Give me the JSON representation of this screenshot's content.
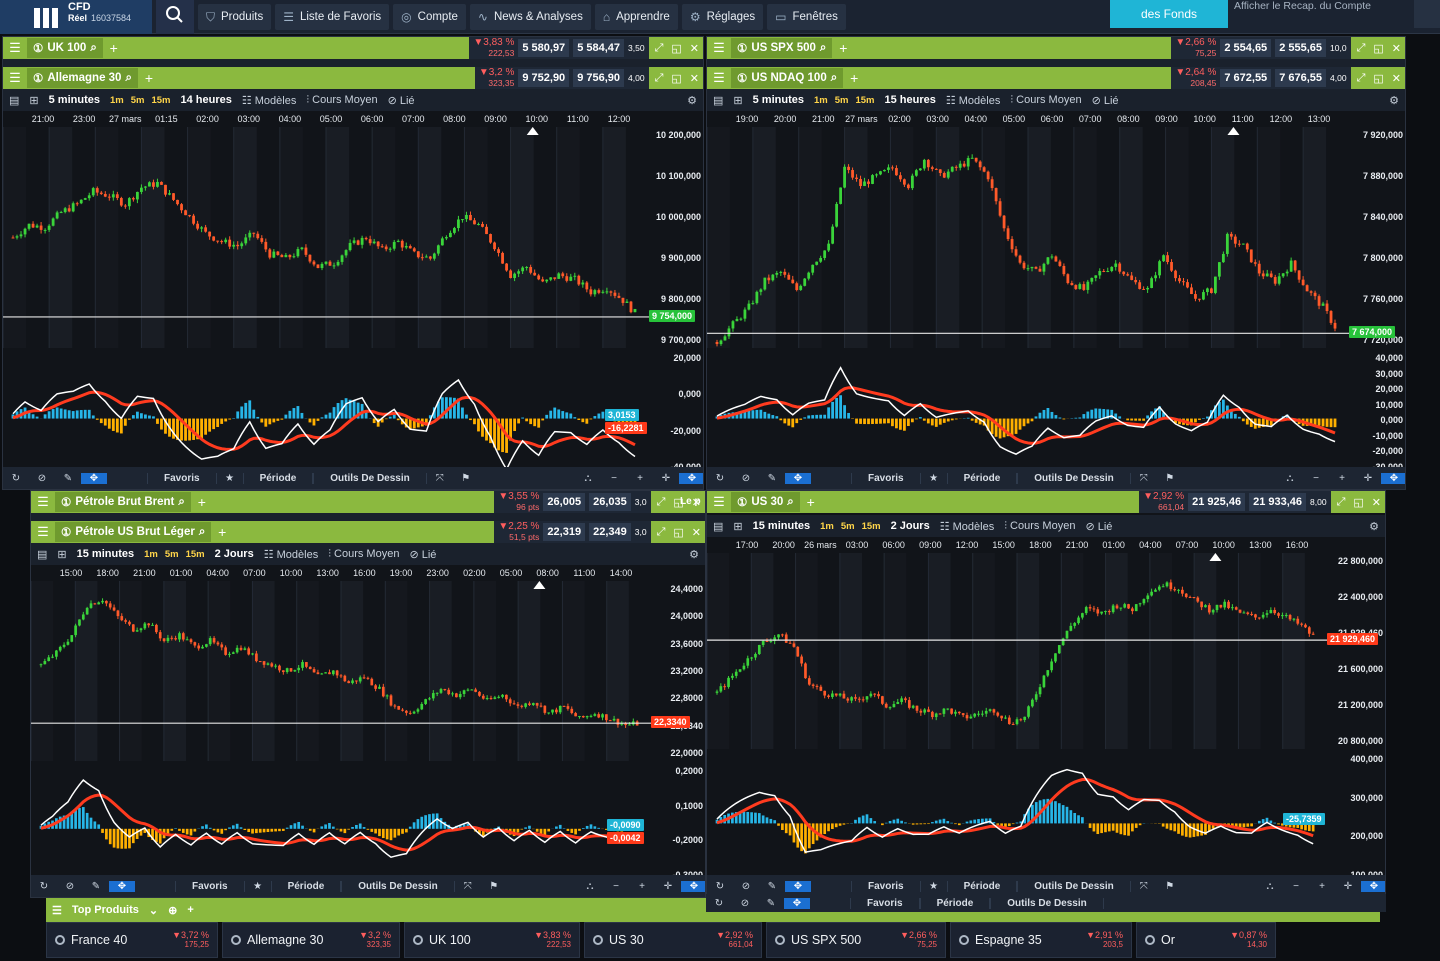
{
  "app": {
    "brand_line1": "CFD",
    "brand_line2_strong": "Réel",
    "brand_line2": "16037584",
    "nav": [
      {
        "icon": "shield-icon",
        "glyph": "⛉",
        "label": "Produits"
      },
      {
        "icon": "list-icon",
        "glyph": "☰",
        "label": "Liste de Favoris"
      },
      {
        "icon": "coins-icon",
        "glyph": "◎",
        "label": "Compte"
      },
      {
        "icon": "pulse-icon",
        "glyph": "∿",
        "label": "News & Analyses"
      },
      {
        "icon": "graduation-icon",
        "glyph": "⌂",
        "label": "Apprendre"
      },
      {
        "icon": "gear-icon",
        "glyph": "⚙",
        "label": "Réglages"
      },
      {
        "icon": "window-icon",
        "glyph": "▭",
        "label": "Fenêtres"
      }
    ],
    "funds_button": "des Fonds",
    "recap_link": "Afficher le Recap. du Compte"
  },
  "colors": {
    "green_bar": "#8bb93f",
    "bull": "#3ad43a",
    "bear": "#ff5a2a",
    "macd_hist_pos": "#27b6e8",
    "macd_hist_neg": "#ffb000",
    "signal": "#ff3b1f",
    "macd_line": "#ffffff"
  },
  "panels": {
    "tl": {
      "header1": {
        "name": "UK 100",
        "chg": "▼3,83 %",
        "chg_pts": "222,53",
        "bid": "5 580,97",
        "ask": "5 584,47",
        "spread": "3,50"
      },
      "header2": {
        "name": "Allemagne 30",
        "chg": "▼3,2 %",
        "chg_pts": "323,35",
        "bid": "9 752,90",
        "ask": "9 756,90",
        "spread": "4,00"
      },
      "period": "5 minutes",
      "range": "14 heures",
      "tools": [
        "Modèles",
        "Cours Moyen",
        "Lié"
      ],
      "timeframes": [
        "1m",
        "5m",
        "15m"
      ],
      "time_ticks": [
        "21:00",
        "23:00",
        "27 mars",
        "01:15",
        "02:00",
        "03:00",
        "04:00",
        "05:00",
        "06:00",
        "07:00",
        "08:00",
        "09:00",
        "10:00",
        "11:00",
        "12:00"
      ],
      "price_ticks": [
        "10 200,000",
        "10 100,000",
        "10 000,000",
        "9 900,000",
        "9 800,000",
        "9 700,000"
      ],
      "macd_ticks": [
        "20,000",
        "0,000",
        "-20,000",
        "-40,000"
      ],
      "price_tag": "9 754,000",
      "macd_tags": [
        "3,0153",
        "-16,2281"
      ],
      "footer": [
        "Favoris",
        "Période",
        "Outils De Dessin"
      ]
    },
    "tr": {
      "header1": {
        "name": "US SPX 500",
        "chg": "▼2,66 %",
        "chg_pts": "75,25",
        "bid": "2 554,65",
        "ask": "2 555,65",
        "spread": "10,0"
      },
      "header2": {
        "name": "US NDAQ 100",
        "chg": "▼2,64 %",
        "chg_pts": "208,45",
        "bid": "7 672,55",
        "ask": "7 676,55",
        "spread": "4,00"
      },
      "period": "5 minutes",
      "range": "15 heures",
      "tools": [
        "Modèles",
        "Cours Moyen",
        "Lié"
      ],
      "timeframes": [
        "1m",
        "5m",
        "15m"
      ],
      "time_ticks": [
        "19:00",
        "20:00",
        "21:00",
        "27 mars",
        "02:00",
        "03:00",
        "04:00",
        "05:00",
        "06:00",
        "07:00",
        "08:00",
        "09:00",
        "10:00",
        "11:00",
        "12:00",
        "13:00"
      ],
      "price_ticks": [
        "7 920,000",
        "7 880,000",
        "7 840,000",
        "7 800,000",
        "7 760,000",
        "7 720,000"
      ],
      "macd_ticks": [
        "40,000",
        "30,000",
        "20,000",
        "10,000",
        "0,000",
        "-10,000",
        "-20,000",
        "-30,000"
      ],
      "price_tag": "7 674,000",
      "footer": [
        "Favoris",
        "Période",
        "Outils De Dessin"
      ]
    },
    "bl": {
      "header1": {
        "name": "Pétrole Brut Brent",
        "chg": "▼3,55 %",
        "chg_pts": "96 pts",
        "bid": "26,005",
        "ask": "26,035",
        "spread": "3,0"
      },
      "header2": {
        "name": "Pétrole US Brut Léger",
        "chg": "▼2,25 %",
        "chg_pts": "51,5 pts",
        "bid": "22,319",
        "ask": "22,349",
        "spread": "3,0"
      },
      "period": "15 minutes",
      "range": "2 Jours",
      "tools": [
        "Modèles",
        "Cours Moyen",
        "Lié"
      ],
      "timeframes": [
        "1m",
        "5m",
        "15m"
      ],
      "time_ticks": [
        "15:00",
        "18:00",
        "21:00",
        "01:00",
        "04:00",
        "07:00",
        "10:00",
        "13:00",
        "16:00",
        "19:00",
        "23:00",
        "02:00",
        "05:00",
        "08:00",
        "11:00",
        "14:00"
      ],
      "price_ticks": [
        "24,4000",
        "24,0000",
        "23,6000",
        "23,2000",
        "22,8000",
        "22,3340",
        "22,0000"
      ],
      "macd_ticks": [
        "0,2000",
        "0,1000",
        "-0,2000",
        "-0,3000"
      ],
      "price_tag": "22,3340",
      "macd_tags": [
        "-0,0090",
        "-0,0042"
      ],
      "footer": [
        "Favoris",
        "Période",
        "Outils De Dessin"
      ],
      "side_text": "Le p"
    },
    "br": {
      "header1": {
        "name": "US 30",
        "chg": "▼2,92 %",
        "chg_pts": "661,04",
        "bid": "21 925,46",
        "ask": "21 933,46",
        "spread": "8,00"
      },
      "period": "15 minutes",
      "range": "2 Jours",
      "tools": [
        "Modèles",
        "Cours Moyen",
        "Lié"
      ],
      "timeframes": [
        "1m",
        "5m",
        "15m"
      ],
      "time_ticks": [
        "17:00",
        "20:00",
        "26 mars",
        "03:00",
        "06:00",
        "09:00",
        "12:00",
        "15:00",
        "18:00",
        "21:00",
        "01:00",
        "04:00",
        "07:00",
        "10:00",
        "13:00",
        "16:00"
      ],
      "price_ticks": [
        "22 800,000",
        "22 400,000",
        "21 929,460",
        "21 600,000",
        "21 200,000",
        "20 800,000"
      ],
      "macd_ticks": [
        "400,000",
        "300,000",
        "200,000",
        "100,000"
      ],
      "price_tag": "21 929,460",
      "macd_tags": [
        "-25,7359"
      ],
      "footer": [
        "Favoris",
        "Période",
        "Outils De Dessin"
      ]
    }
  },
  "ticker": {
    "head": "Top Produits",
    "items": [
      {
        "name": "France 40",
        "chg": "▼3,72 %",
        "pts": "175,25"
      },
      {
        "name": "Allemagne 30",
        "chg": "▼3,2 %",
        "pts": "323,35"
      },
      {
        "name": "UK 100",
        "chg": "▼3,83 %",
        "pts": "222,53"
      },
      {
        "name": "US 30",
        "chg": "▼2,92 %",
        "pts": "661,04"
      },
      {
        "name": "US SPX 500",
        "chg": "▼2,66 %",
        "pts": "75,25"
      },
      {
        "name": "Espagne 35",
        "chg": "▼2,91 %",
        "pts": "203,5"
      },
      {
        "name": "Or",
        "chg": "▼0,87 %",
        "pts": "14,30"
      }
    ]
  },
  "chart_data": [
    {
      "type": "line",
      "name": "Allemagne 30",
      "y": [
        9950,
        9980,
        9975,
        10010,
        10030,
        10060,
        10050,
        10030,
        10070,
        10080,
        10040,
        10000,
        9960,
        9940,
        9930,
        9960,
        9910,
        9900,
        9920,
        9880,
        9890,
        9930,
        9950,
        9920,
        9940,
        9910,
        9900,
        9960,
        10000,
        9980,
        9930,
        9860,
        9880,
        9840,
        9860,
        9850,
        9820,
        9830,
        9800,
        9760
      ],
      "ylim": [
        9700,
        10200
      ]
    },
    {
      "type": "line",
      "name": "US NDAQ 100",
      "y": [
        7680,
        7700,
        7720,
        7750,
        7760,
        7740,
        7770,
        7790,
        7880,
        7860,
        7870,
        7880,
        7860,
        7890,
        7870,
        7880,
        7890,
        7870,
        7810,
        7770,
        7760,
        7780,
        7750,
        7740,
        7760,
        7770,
        7750,
        7740,
        7780,
        7750,
        7730,
        7740,
        7800,
        7790,
        7760,
        7750,
        7770,
        7740,
        7720,
        7690
      ],
      "ylim": [
        7680,
        7920
      ]
    },
    {
      "type": "line",
      "name": "Pétrole US Brut Léger",
      "y": [
        23.3,
        23.5,
        23.8,
        24.3,
        24.4,
        24.1,
        23.9,
        24.0,
        23.7,
        23.8,
        23.6,
        23.7,
        23.5,
        23.6,
        23.4,
        23.3,
        23.2,
        23.3,
        23.1,
        23.2,
        23.0,
        23.1,
        22.9,
        22.6,
        22.5,
        22.7,
        22.9,
        22.8,
        22.9,
        22.7,
        22.8,
        22.6,
        22.7,
        22.5,
        22.6,
        22.4,
        22.5,
        22.4,
        22.3,
        22.33
      ],
      "ylim": [
        21.8,
        24.6
      ]
    },
    {
      "type": "line",
      "name": "US 30",
      "y": [
        21300,
        21500,
        21700,
        21900,
        22000,
        21850,
        21400,
        21300,
        21250,
        21200,
        21300,
        21150,
        21200,
        21100,
        21050,
        21100,
        21000,
        21050,
        21100,
        20950,
        21000,
        21400,
        21800,
        22100,
        22300,
        22250,
        22350,
        22300,
        22500,
        22600,
        22550,
        22400,
        22300,
        22350,
        22250,
        22200,
        22300,
        22200,
        22100,
        21930
      ],
      "ylim": [
        20700,
        22900
      ]
    }
  ]
}
